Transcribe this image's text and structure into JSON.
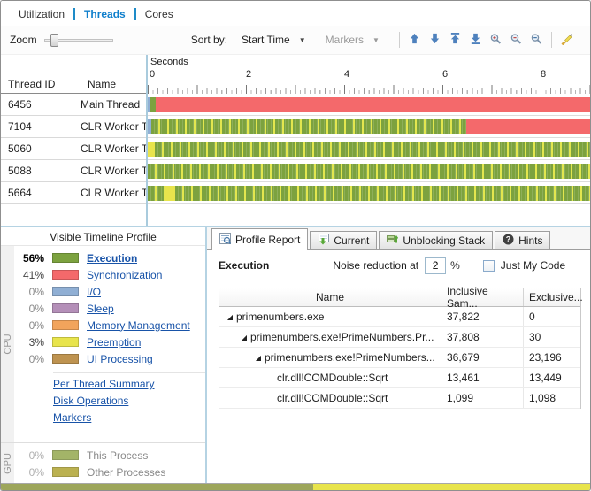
{
  "view_tabs": [
    {
      "label": "Utilization",
      "active": false
    },
    {
      "label": "Threads",
      "active": true
    },
    {
      "label": "Cores",
      "active": false
    }
  ],
  "toolbar": {
    "zoom_label": "Zoom",
    "sort_by_label": "Sort by:",
    "sort_value": "Start Time",
    "markers_label": "Markers"
  },
  "timeline": {
    "seconds_label": "Seconds",
    "ticks": [
      "0",
      "2",
      "4",
      "6",
      "8"
    ],
    "lanes": [
      {
        "thread": "6456",
        "segments": [
          {
            "type": "io",
            "w": 0.5
          },
          {
            "type": "exec",
            "w": 1.2
          },
          {
            "type": "sync",
            "w": 98.3
          }
        ]
      },
      {
        "thread": "7104",
        "segments": [
          {
            "type": "io",
            "w": 0.7
          },
          {
            "type": "mix",
            "w": 71.3
          },
          {
            "type": "sync",
            "w": 28.0
          }
        ]
      },
      {
        "thread": "5060",
        "segments": [
          {
            "type": "preempt",
            "w": 1.5
          },
          {
            "type": "mix",
            "w": 98.5
          }
        ]
      },
      {
        "thread": "5088",
        "segments": [
          {
            "type": "mix",
            "w": 100
          }
        ]
      },
      {
        "thread": "5664",
        "segments": [
          {
            "type": "mix",
            "w": 4
          },
          {
            "type": "preempt",
            "w": 2.2
          },
          {
            "type": "mix",
            "w": 93.8
          }
        ]
      }
    ]
  },
  "thread_table": {
    "columns": [
      "Thread ID",
      "Name"
    ],
    "rows": [
      {
        "id": "6456",
        "name": "Main Thread"
      },
      {
        "id": "7104",
        "name": "CLR Worker T..."
      },
      {
        "id": "5060",
        "name": "CLR Worker T..."
      },
      {
        "id": "5088",
        "name": "CLR Worker T..."
      },
      {
        "id": "5664",
        "name": "CLR Worker T..."
      }
    ]
  },
  "profile_panel": {
    "title": "Visible Timeline Profile",
    "cpu_label": "CPU",
    "gpu_label": "GPU",
    "cpu_legend": [
      {
        "pct": "56%",
        "label": "Execution",
        "color": "#7ca23f"
      },
      {
        "pct": "41%",
        "label": "Synchronization",
        "color": "#f4696b"
      },
      {
        "pct": "0%",
        "label": "I/O",
        "color": "#90afd4"
      },
      {
        "pct": "0%",
        "label": "Sleep",
        "color": "#b48fb8"
      },
      {
        "pct": "0%",
        "label": "Memory Management",
        "color": "#f2a45c"
      },
      {
        "pct": "3%",
        "label": "Preemption",
        "color": "#e8e44c"
      },
      {
        "pct": "0%",
        "label": "UI Processing",
        "color": "#be9350"
      }
    ],
    "links": [
      "Per Thread Summary",
      "Disk Operations",
      "Markers"
    ],
    "gpu_legend": [
      {
        "pct": "0%",
        "label": "This Process",
        "color": "#94a84e"
      },
      {
        "pct": "0%",
        "label": "Other Processes",
        "color": "#b0a432"
      }
    ]
  },
  "report_panel": {
    "tabs": [
      {
        "label": "Profile Report"
      },
      {
        "label": "Current"
      },
      {
        "label": "Unblocking Stack"
      },
      {
        "label": "Hints"
      }
    ],
    "section_label": "Execution",
    "noise_label": "Noise reduction at",
    "noise_value": "2",
    "percent_label": "%",
    "jmc_label": "Just My Code",
    "table": {
      "columns": [
        "Name",
        "Inclusive Sam...",
        "Exclusive..."
      ],
      "rows": [
        {
          "name": "primenumbers.exe",
          "inclusive": "37,822",
          "exclusive": "0",
          "indent": 0,
          "expanded": true
        },
        {
          "name": "primenumbers.exe!PrimeNumbers.Pr...",
          "inclusive": "37,808",
          "exclusive": "30",
          "indent": 1,
          "expanded": true
        },
        {
          "name": "primenumbers.exe!PrimeNumbers...",
          "inclusive": "36,679",
          "exclusive": "23,196",
          "indent": 2,
          "expanded": true
        },
        {
          "name": "clr.dll!COMDouble::Sqrt",
          "inclusive": "13,461",
          "exclusive": "13,449",
          "indent": 3,
          "expanded": false
        },
        {
          "name": "clr.dll!COMDouble::Sqrt",
          "inclusive": "1,099",
          "exclusive": "1,098",
          "indent": 3,
          "expanded": false
        }
      ]
    }
  },
  "bottom_strip": {
    "segments": [
      {
        "color": "#9da65b",
        "w": 53
      },
      {
        "color": "#e8e44c",
        "w": 47
      }
    ]
  }
}
